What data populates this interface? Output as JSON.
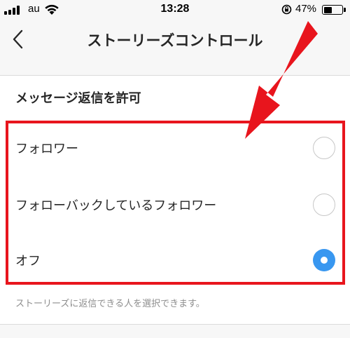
{
  "status_bar": {
    "carrier": "au",
    "time": "13:28",
    "battery_percent": "47%",
    "battery_level": 0.47
  },
  "nav": {
    "title": "ストーリーズコントロール",
    "back_icon": "chevron-left-icon"
  },
  "section": {
    "title": "メッセージ返信を許可",
    "options": [
      {
        "label": "フォロワー",
        "selected": false
      },
      {
        "label": "フォローバックしているフォロワー",
        "selected": false
      },
      {
        "label": "オフ",
        "selected": true
      }
    ],
    "footer_note": "ストーリーズに返信できる人を選択できます。"
  },
  "annotation": {
    "color": "#e8151d"
  },
  "colors": {
    "accent": "#3897f0",
    "text": "#262626",
    "muted": "#8e8e8e"
  }
}
